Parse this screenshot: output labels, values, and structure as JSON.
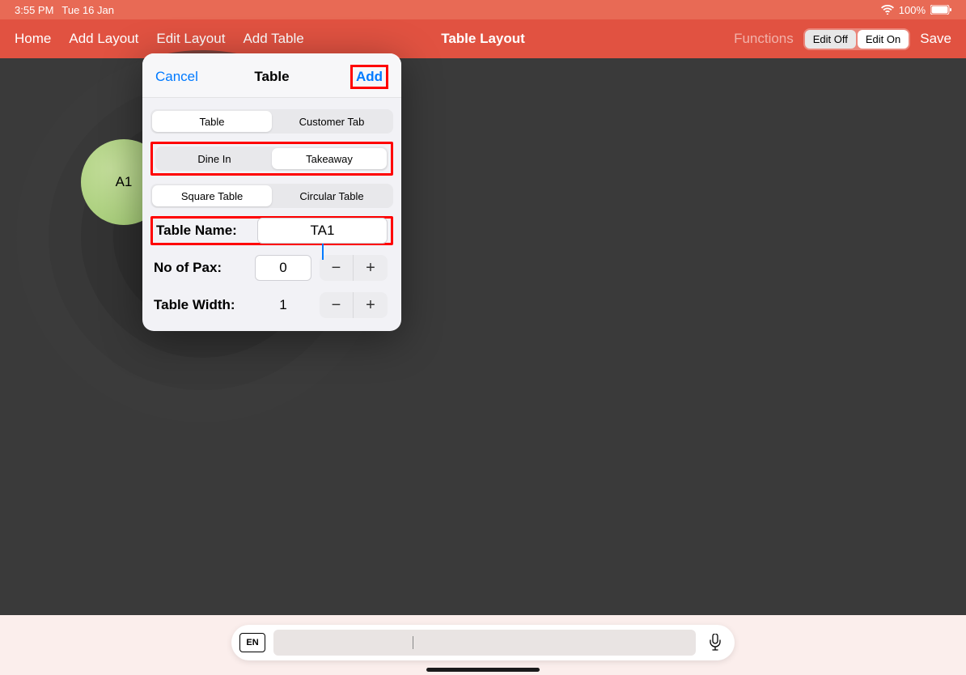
{
  "status": {
    "time": "3:55 PM",
    "date": "Tue 16 Jan",
    "battery": "100%"
  },
  "toolbar": {
    "home": "Home",
    "add_layout": "Add Layout",
    "edit_layout": "Edit Layout",
    "add_table": "Add Table",
    "title": "Table Layout",
    "functions": "Functions",
    "edit_off": "Edit Off",
    "edit_on": "Edit On",
    "save": "Save"
  },
  "table_marker": {
    "label": "A1"
  },
  "popover": {
    "cancel": "Cancel",
    "title": "Table",
    "add": "Add",
    "seg1_a": "Table",
    "seg1_b": "Customer Tab",
    "seg2_a": "Dine In",
    "seg2_b": "Takeaway",
    "seg3_a": "Square Table",
    "seg3_b": "Circular Table",
    "table_name_label": "Table Name:",
    "table_name_value": "TA1",
    "pax_label": "No of Pax:",
    "pax_value": "0",
    "width_label": "Table Width:",
    "width_value": "1"
  },
  "keyboard": {
    "lang": "EN"
  }
}
